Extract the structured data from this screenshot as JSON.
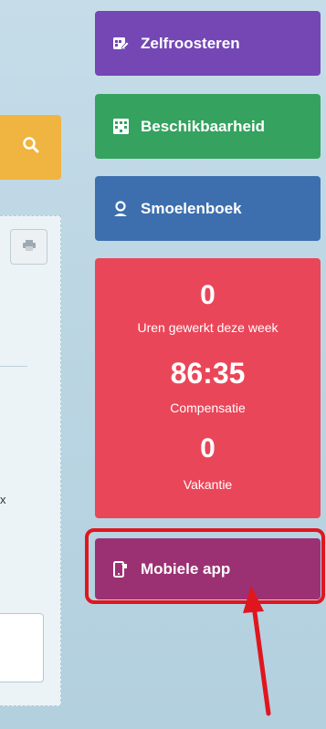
{
  "sidebar": {
    "buttons": [
      {
        "label": "Zelfroosteren",
        "icon": "calendar-edit-icon",
        "color": "#7447b5"
      },
      {
        "label": "Beschikbaarheid",
        "icon": "grid-calendar-icon",
        "color": "#35a25f"
      },
      {
        "label": "Smoelenboek",
        "icon": "user-icon",
        "color": "#3d6fae"
      }
    ],
    "mobile_app": {
      "label": "Mobiele app",
      "icon": "mobile-icon",
      "color": "#9b3172"
    }
  },
  "stats": {
    "color": "#ea4659",
    "hours_value": "0",
    "hours_label": "Uren gewerkt deze week",
    "comp_value": "86:35",
    "comp_label": "Compensatie",
    "vac_value": "0",
    "vac_label": "Vakantie"
  },
  "left_panel": {
    "search_icon": "search-icon",
    "search_color": "#f0b441",
    "print_icon": "print-icon",
    "fragment_text": "x"
  },
  "annotation": {
    "highlight_color": "#e0161e"
  }
}
